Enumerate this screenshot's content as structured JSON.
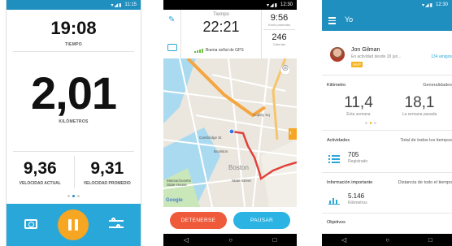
{
  "phone1": {
    "status_time": "11:15",
    "time_value": "19:08",
    "time_label": "TIEMPO",
    "distance_value": "2,01",
    "distance_label": "KILÓMETROS",
    "current_speed_value": "9,36",
    "current_speed_label": "VELOCIDAD ACTUAL",
    "avg_speed_value": "9,31",
    "avg_speed_label": "VELOCIDAD PROMEDIO",
    "accent": "#2aa7d9",
    "pause_color": "#f7a623"
  },
  "phone2": {
    "status_time": "12:30",
    "time_label": "Tiempo",
    "time_value": "22:21",
    "gps_text": "Buena señal de GPS",
    "pace_value": "9:56",
    "pace_label": "Km/h promedio",
    "calories_value": "246",
    "calories_label": "Calorías",
    "stop_label": "DETENERSE",
    "pause_label": "PAUSAR",
    "map_labels": {
      "copley": "Copley Sq",
      "boylston": "Boylston",
      "boston": "Boston",
      "state_street": "State Street",
      "state_house": "Massachusetts State House",
      "cambridge": "Cambridge St",
      "google": "Google"
    },
    "stop_color": "#ee5a3a",
    "pause_color": "#2ab3e3"
  },
  "phone3": {
    "status_time": "12:30",
    "title": "Yo",
    "user_name": "Jon Gilman",
    "user_sub": "En actividad desde 18 jun...",
    "friends_link": "134 amigos",
    "badge": "MVP",
    "km_section": "Kilómetro",
    "km_filter": "Generalidades",
    "week_value": "11,4",
    "week_label": "Esta semana",
    "last_week_value": "18,1",
    "last_week_label": "La semana pasada",
    "activities_label": "Actividades",
    "activities_filter": "Total de todos los tiempos",
    "activities_value": "705",
    "activities_sub": "Registrado",
    "info_label": "Información importante",
    "info_filter": "Distancia de todo el tiempo",
    "distance_value": "5.146",
    "distance_sub": "Kilómetros",
    "goals_label": "Objetivos",
    "header_color": "#1f8fc0"
  }
}
